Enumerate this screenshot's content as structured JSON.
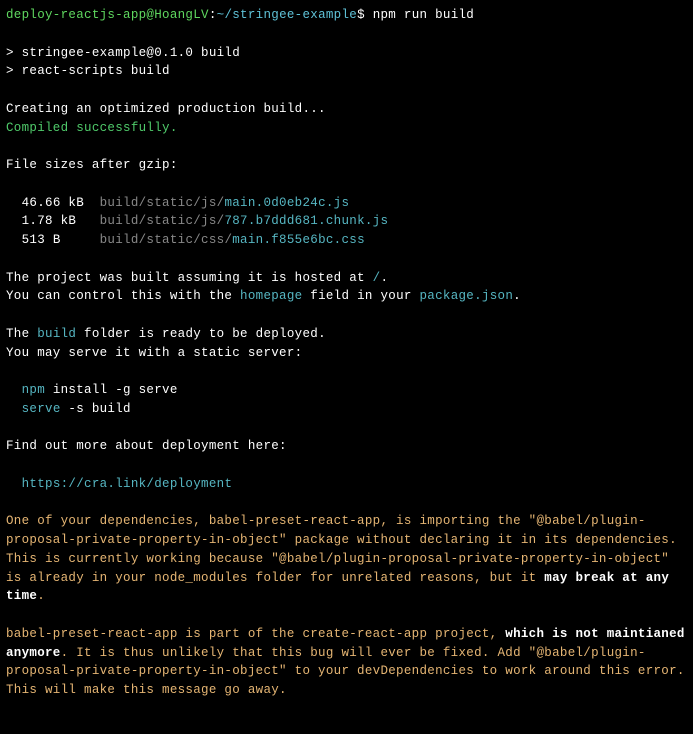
{
  "prompt": {
    "userHost": "deploy-reactjs-app@HoangLV",
    "colon": ":",
    "path": "~/stringee-example",
    "dollar": "$ ",
    "command": "npm run build"
  },
  "lines": {
    "build1": "> stringee-example@0.1.0 build",
    "build2": "> react-scripts build",
    "creating": "Creating an optimized production build...",
    "compiled": "Compiled successfully.",
    "filesizes": "File sizes after gzip:",
    "f1": {
      "size": "  46.66 kB  ",
      "path": "build/static/js/",
      "file": "main.0d0eb24c.js"
    },
    "f2": {
      "size": "  1.78 kB   ",
      "path": "build/static/js/",
      "file": "787.b7ddd681.chunk.js"
    },
    "f3": {
      "size": "  513 B     ",
      "path": "build/static/css/",
      "file": "main.f855e6bc.css"
    },
    "hosted1": "The project was built assuming it is hosted at ",
    "hosted2": "/",
    "hosted3": ".",
    "control1": "You can control this with the ",
    "homepage": "homepage",
    "control2": " field in your ",
    "packagejson": "package.json",
    "control3": ".",
    "the": "The ",
    "build": "build",
    "ready": " folder is ready to be deployed.",
    "serve": "You may serve it with a static server:",
    "npm": "npm",
    "npminstall": " install -g serve",
    "serveCmd": "serve",
    "serveArgs": " -s build",
    "findout": "Find out more about deployment here:",
    "deploylink": "https://cra.link/deployment",
    "warn1": "One of your dependencies, babel-preset-react-app, is importing the \"@babel/plugin-proposal-private-property-in-object\" package without declaring it in its dependencies. This is currently working because \"@babel/plugin-proposal-private-property-in-object\" is already in your node_modules folder for unrelated reasons, but it ",
    "warn1b": "may break at any time",
    "warn1c": ".",
    "warn2a": "babel-preset-react-app is part of the create-react-app project, ",
    "warn2b": "which is not maintianed anymore",
    "warn2c": ". It is thus unlikely that this bug will ever be fixed. Add \"@babel/plugin-proposal-private-property-in-object\" to your devDependencies to work around this error. This will make this message go away."
  }
}
